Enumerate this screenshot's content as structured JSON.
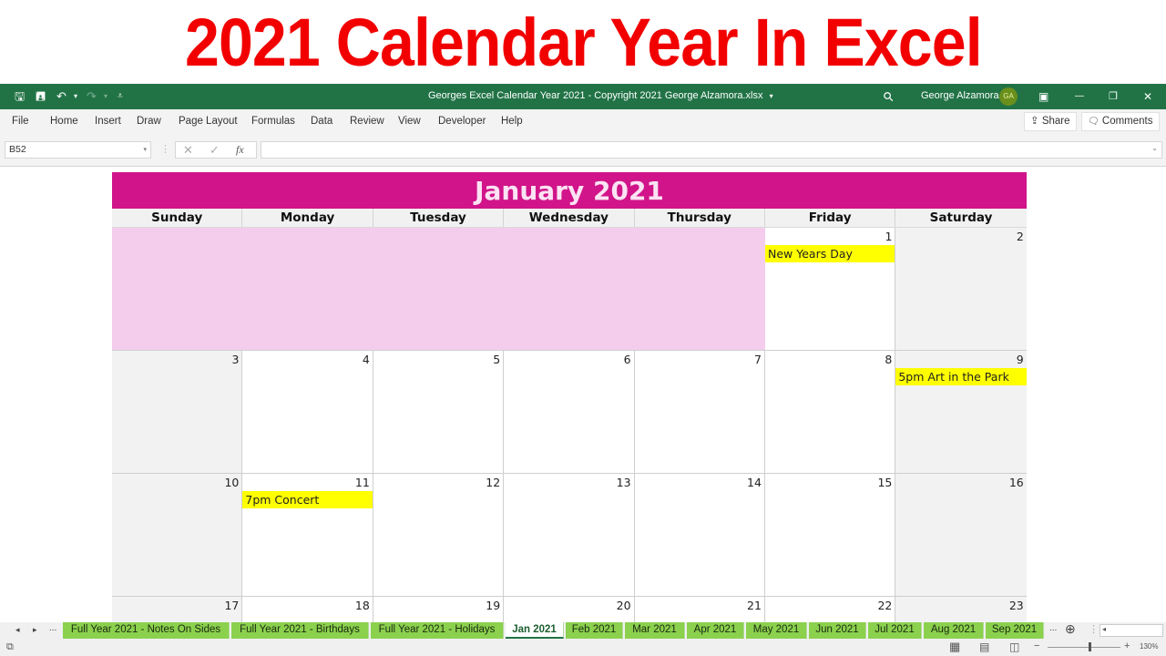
{
  "banner": {
    "title": "2021 Calendar Year In Excel"
  },
  "titlebar": {
    "document_title": "Georges Excel Calendar Year 2021 - Copyright 2021 George Alzamora.xlsx",
    "user_name": "George Alzamora",
    "user_initials": "GA",
    "icons": {
      "save": "save-icon",
      "autosave": "autosave-icon",
      "undo": "undo-icon",
      "redo": "redo-icon",
      "customize": "customize-qat-icon",
      "search": "search-icon",
      "ribbon_display": "ribbon-display-icon",
      "minimize": "minimize-icon",
      "restore": "restore-icon",
      "close": "close-icon"
    },
    "glyphs": {
      "save": "🖫",
      "autosave": "🖪",
      "undo": "↶",
      "undo_dd": "▾",
      "redo": "↷",
      "redo_dd": "▾",
      "customize": "⩡",
      "dropdown": "▾",
      "search": "⚲",
      "ribbon_display": "▣",
      "minimize": "—",
      "restore": "❐",
      "close": "✕"
    }
  },
  "ribbon": {
    "tabs": [
      "File",
      "Home",
      "Insert",
      "Draw",
      "Page Layout",
      "Formulas",
      "Data",
      "Review",
      "View",
      "Developer",
      "Help"
    ],
    "share_label": "Share",
    "comments_label": "Comments",
    "share_glyph": "⇪",
    "comments_glyph": "🗨"
  },
  "formula_bar": {
    "name_box": "B52",
    "formula_value": "",
    "glyphs": {
      "dropdown": "▾",
      "dots": "⋮",
      "cancel": "✕",
      "enter": "✓",
      "fx": "fx",
      "expand": "⌄"
    }
  },
  "calendar": {
    "title": "January 2021",
    "header_color": "#d1148a",
    "blank_color": "#f4cdec",
    "event_color": "#ffff00",
    "days_of_week": [
      "Sunday",
      "Monday",
      "Tuesday",
      "Wednesday",
      "Thursday",
      "Friday",
      "Saturday"
    ],
    "weeks": [
      {
        "blank_span": 5,
        "days": [
          {
            "date": "1",
            "event": "New Years Day"
          },
          {
            "date": "2",
            "event": ""
          }
        ]
      },
      {
        "blank_span": 0,
        "days": [
          {
            "date": "3",
            "event": ""
          },
          {
            "date": "4",
            "event": ""
          },
          {
            "date": "5",
            "event": ""
          },
          {
            "date": "6",
            "event": ""
          },
          {
            "date": "7",
            "event": ""
          },
          {
            "date": "8",
            "event": ""
          },
          {
            "date": "9",
            "event": "5pm Art in the Park"
          }
        ]
      },
      {
        "blank_span": 0,
        "days": [
          {
            "date": "10",
            "event": ""
          },
          {
            "date": "11",
            "event": "7pm Concert"
          },
          {
            "date": "12",
            "event": ""
          },
          {
            "date": "13",
            "event": ""
          },
          {
            "date": "14",
            "event": ""
          },
          {
            "date": "15",
            "event": ""
          },
          {
            "date": "16",
            "event": ""
          }
        ]
      },
      {
        "blank_span": 0,
        "days": [
          {
            "date": "17",
            "event": ""
          },
          {
            "date": "18",
            "event": ""
          },
          {
            "date": "19",
            "event": ""
          },
          {
            "date": "20",
            "event": ""
          },
          {
            "date": "21",
            "event": ""
          },
          {
            "date": "22",
            "event": ""
          },
          {
            "date": "23",
            "event": ""
          }
        ]
      }
    ]
  },
  "sheet_tabs": {
    "nav": {
      "prev": "◂",
      "next": "▸",
      "more": "...",
      "more_right": "...",
      "add": "⊕",
      "split": "⋮"
    },
    "tabs": [
      {
        "label": "Full Year 2021 - Notes On Sides",
        "active": false
      },
      {
        "label": "Full Year 2021 - Birthdays",
        "active": false
      },
      {
        "label": "Full Year 2021 - Holidays",
        "active": false
      },
      {
        "label": "Jan 2021",
        "active": true
      },
      {
        "label": "Feb 2021",
        "active": false
      },
      {
        "label": "Mar 2021",
        "active": false
      },
      {
        "label": "Apr 2021",
        "active": false
      },
      {
        "label": "May 2021",
        "active": false
      },
      {
        "label": "Jun 2021",
        "active": false
      },
      {
        "label": "Jul 2021",
        "active": false
      },
      {
        "label": "Aug 2021",
        "active": false
      },
      {
        "label": "Sep 2021",
        "active": false
      }
    ],
    "tab_color": "#8bd14e"
  },
  "status_bar": {
    "zoom_level": "130%",
    "zoom_fraction": 0.57,
    "glyphs": {
      "macro": "⧉",
      "normal_view": "▦",
      "page_layout_view": "▤",
      "page_break_view": "◫",
      "zoom_out": "−",
      "zoom_in": "+",
      "scroll_left": "◂",
      "scroll_right": "▸"
    }
  }
}
